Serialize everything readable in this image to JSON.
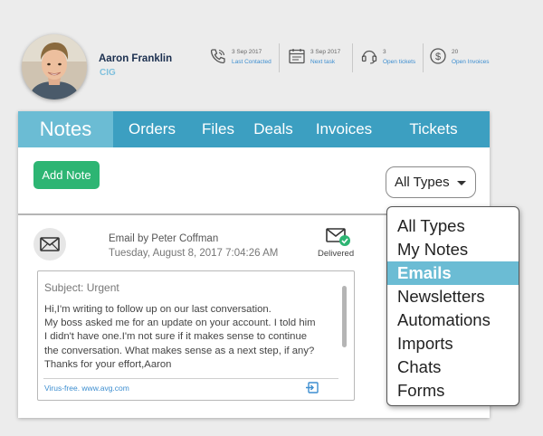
{
  "contact": {
    "name": "Aaron Franklin",
    "company": "CIG"
  },
  "stats": [
    {
      "icon": "phone-icon",
      "value": "3 Sep 2017",
      "label": "Last Contacted"
    },
    {
      "icon": "calendar-icon",
      "value": "3 Sep 2017",
      "label": "Next task"
    },
    {
      "icon": "headset-icon",
      "value": "3",
      "label": "Open tickets"
    },
    {
      "icon": "dollar-icon",
      "value": "20",
      "label": "Open Invoices"
    }
  ],
  "tabs": [
    {
      "label": "Notes",
      "active": true
    },
    {
      "label": "Orders"
    },
    {
      "label": "Files"
    },
    {
      "label": "Deals"
    },
    {
      "label": "Invoices"
    },
    {
      "label": "Tickets"
    }
  ],
  "toolbar": {
    "add_note_label": "Add Note",
    "type_select_value": "All Types"
  },
  "note": {
    "from": "Email by Peter Coffman",
    "date": "Tuesday, August 8, 2017 7:04:26 AM",
    "status": "Delivered",
    "subject": "Subject: Urgent",
    "body": [
      "Hi,I'm writing to follow up on our last conversation.",
      "My boss asked me for an update on your account. I told him",
      "I didn't have one.I'm not sure if it makes sense to continue",
      "the conversation. What makes sense as a next step, if any?",
      "Thanks for your effort,Aaron"
    ],
    "signature": "Virus-free. www.avg.com"
  },
  "type_menu": {
    "options": [
      "All Types",
      "My Notes",
      "Emails",
      "Newsletters",
      "Automations",
      "Imports",
      "Chats",
      "Forms"
    ],
    "selected_index": 2
  },
  "colors": {
    "tab_bar": "#3c9fc1",
    "tab_active": "#6bbcd4",
    "add_button": "#2db573",
    "link": "#3d8ed0",
    "delivered_check": "#2db573"
  }
}
